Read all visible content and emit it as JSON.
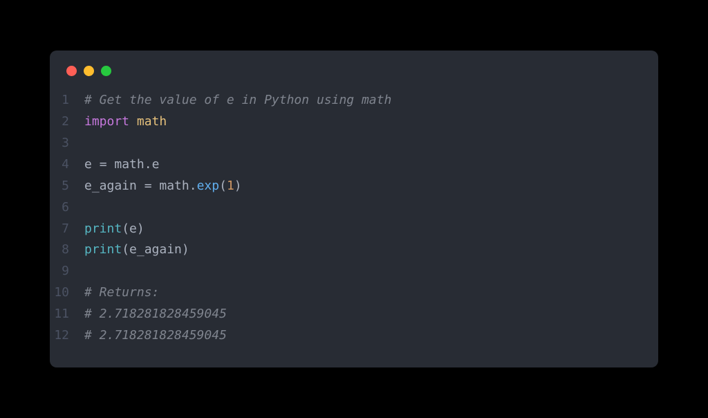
{
  "window": {
    "controls": {
      "close": "close",
      "minimize": "minimize",
      "maximize": "maximize"
    }
  },
  "code": {
    "lines": [
      {
        "num": "1",
        "tokens": [
          {
            "t": "# Get the value of e in Python using math",
            "c": "comment"
          }
        ]
      },
      {
        "num": "2",
        "tokens": [
          {
            "t": "import",
            "c": "keyword"
          },
          {
            "t": " ",
            "c": "plain"
          },
          {
            "t": "math",
            "c": "module"
          }
        ]
      },
      {
        "num": "3",
        "tokens": []
      },
      {
        "num": "4",
        "tokens": [
          {
            "t": "e ",
            "c": "plain"
          },
          {
            "t": "=",
            "c": "op"
          },
          {
            "t": " math",
            "c": "plain"
          },
          {
            "t": ".",
            "c": "punct"
          },
          {
            "t": "e",
            "c": "plain"
          }
        ]
      },
      {
        "num": "5",
        "tokens": [
          {
            "t": "e_again ",
            "c": "plain"
          },
          {
            "t": "=",
            "c": "op"
          },
          {
            "t": " math",
            "c": "plain"
          },
          {
            "t": ".",
            "c": "punct"
          },
          {
            "t": "exp",
            "c": "func"
          },
          {
            "t": "(",
            "c": "punct"
          },
          {
            "t": "1",
            "c": "num"
          },
          {
            "t": ")",
            "c": "punct"
          }
        ]
      },
      {
        "num": "6",
        "tokens": []
      },
      {
        "num": "7",
        "tokens": [
          {
            "t": "print",
            "c": "builtin"
          },
          {
            "t": "(",
            "c": "punct"
          },
          {
            "t": "e",
            "c": "plain"
          },
          {
            "t": ")",
            "c": "punct"
          }
        ]
      },
      {
        "num": "8",
        "tokens": [
          {
            "t": "print",
            "c": "builtin"
          },
          {
            "t": "(",
            "c": "punct"
          },
          {
            "t": "e_again",
            "c": "plain"
          },
          {
            "t": ")",
            "c": "punct"
          }
        ]
      },
      {
        "num": "9",
        "tokens": []
      },
      {
        "num": "10",
        "tokens": [
          {
            "t": "# Returns:",
            "c": "comment"
          }
        ]
      },
      {
        "num": "11",
        "tokens": [
          {
            "t": "# 2.718281828459045",
            "c": "comment"
          }
        ]
      },
      {
        "num": "12",
        "tokens": [
          {
            "t": "# 2.718281828459045",
            "c": "comment"
          }
        ]
      }
    ]
  }
}
